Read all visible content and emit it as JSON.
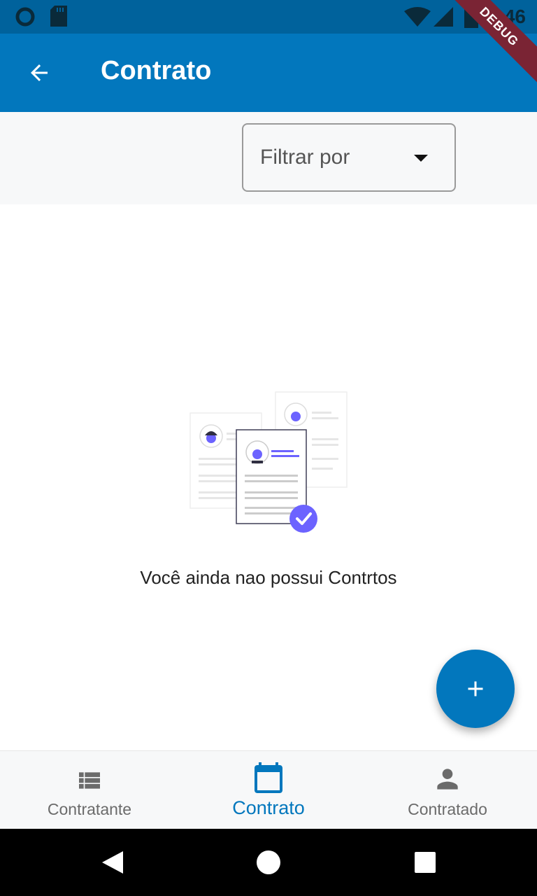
{
  "status_bar": {
    "time": "8:46",
    "icons": [
      "circle-status-icon",
      "sd-card-icon",
      "wifi-icon",
      "signal-icon",
      "battery-icon"
    ]
  },
  "debug_banner": "DEBUG",
  "app_bar": {
    "title": "Contrato",
    "back_icon": "arrow-back-icon"
  },
  "filter": {
    "placeholder": "Filtrar por",
    "icon": "dropdown-arrow-icon"
  },
  "empty_state": {
    "message": "Você ainda nao possui Contrtos",
    "illustration": "documents-checked-illustration"
  },
  "fab": {
    "icon": "plus-icon"
  },
  "bottom_nav": {
    "active_index": 1,
    "items": [
      {
        "label": "Contratante",
        "icon": "list-icon"
      },
      {
        "label": "Contrato",
        "icon": "calendar-icon"
      },
      {
        "label": "Contratado",
        "icon": "person-icon"
      }
    ]
  },
  "colors": {
    "primary": "#0277bd",
    "status_bar": "#00629c",
    "accent_illustration": "#6c63ff",
    "inactive_nav": "#6b6b6b"
  }
}
